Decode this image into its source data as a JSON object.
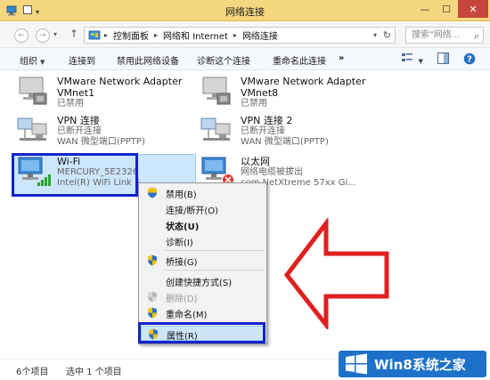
{
  "window": {
    "title": "网络连接",
    "min_glyph": "—",
    "max_glyph": "☐",
    "close_glyph": "✕"
  },
  "address": {
    "crumbs": [
      "控制面板",
      "网络和 Internet",
      "网络连接"
    ],
    "search_placeholder": "搜索\"网络...",
    "search_icon": "magnifier-icon"
  },
  "commands": {
    "organize": "组织",
    "connect_to": "连接到",
    "disable": "禁用此网络设备",
    "diagnose": "诊断这个连接",
    "rename": "重命名此连接",
    "more": "»"
  },
  "connections": [
    {
      "name": "VMware Network Adapter",
      "line2": "VMnet1",
      "line3": "已禁用",
      "kind": "ethernet"
    },
    {
      "name": "VMware Network Adapter",
      "line2": "VMnet8",
      "line3": "已禁用",
      "kind": "ethernet"
    },
    {
      "name": "VPN 连接",
      "line2": "已断开连接",
      "line3": "WAN 微型端口(PPTP)",
      "kind": "vpn"
    },
    {
      "name": "VPN 连接 2",
      "line2": "已断开连接",
      "line3": "WAN 微型端口(PPTP)",
      "kind": "vpn"
    },
    {
      "name": "Wi-Fi",
      "line2": "MERCURY_5E2326",
      "line3": "Intel(R) WiFi Link 5",
      "kind": "wifi"
    },
    {
      "name": "以太网",
      "line2": "网络电缆被拔出",
      "line3": "com NetXtreme 57xx Gi...",
      "kind": "ethernet"
    }
  ],
  "context_menu": [
    {
      "label": "禁用(B)",
      "shield": true,
      "bold": false,
      "disabled": false
    },
    {
      "label": "连接/断开(O)",
      "shield": false,
      "bold": false,
      "disabled": false
    },
    {
      "label": "状态(U)",
      "shield": false,
      "bold": true,
      "disabled": false
    },
    {
      "label": "诊断(I)",
      "shield": false,
      "bold": false,
      "disabled": false
    },
    {
      "label": "桥接(G)",
      "shield": true,
      "bold": false,
      "disabled": false
    },
    {
      "label": "创建快捷方式(S)",
      "shield": false,
      "bold": false,
      "disabled": false
    },
    {
      "label": "删除(D)",
      "shield": true,
      "bold": false,
      "disabled": true
    },
    {
      "label": "重命名(M)",
      "shield": true,
      "bold": false,
      "disabled": false
    },
    {
      "label": "属性(R)",
      "shield": true,
      "bold": false,
      "disabled": false
    }
  ],
  "status": {
    "count": "6个项目",
    "selected": "选中 1 个项目"
  },
  "watermark": {
    "text": "Win8系统之家"
  },
  "colors": {
    "highlight_box": "#1224c9",
    "arrow": "#e11f1f",
    "selection": "#cce6fb",
    "titlebar": "#f4d77e"
  }
}
